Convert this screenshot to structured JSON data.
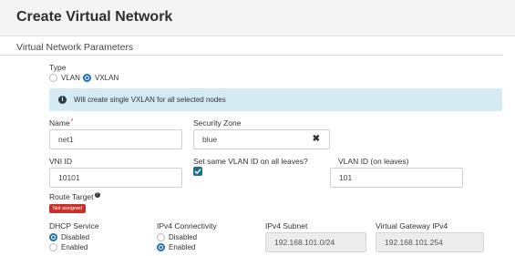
{
  "page": {
    "title": "Create Virtual Network"
  },
  "section": {
    "title": "Virtual Network Parameters"
  },
  "type_field": {
    "label": "Type",
    "options": [
      "VLAN",
      "VXLAN"
    ],
    "selected": "VXLAN"
  },
  "info": {
    "icon": "info-icon",
    "text": "Will create single VXLAN for all selected nodes"
  },
  "name_field": {
    "label": "Name",
    "required_mark": "*",
    "value": "net1"
  },
  "security_zone": {
    "label": "Security Zone",
    "value": "blue",
    "clear_icon": "close-icon",
    "clear_glyph": "✖"
  },
  "vni": {
    "label": "VNI ID",
    "value": "10101"
  },
  "same_vlan": {
    "label": "Set same VLAN ID on all leaves?",
    "checked": true
  },
  "vlan_id": {
    "label": "VLAN ID (on leaves)",
    "value": "101"
  },
  "route_target": {
    "label": "Route Target",
    "help_icon": "help-icon",
    "help_glyph": "?",
    "badge": "Not assigned"
  },
  "dhcp": {
    "label": "DHCP Service",
    "options": [
      "Disabled",
      "Enabled"
    ],
    "selected": "Disabled"
  },
  "ipv4_conn": {
    "label": "IPv4 Connectivity",
    "options": [
      "Disabled",
      "Enabled"
    ],
    "selected": "Enabled"
  },
  "ipv4_subnet": {
    "label": "IPv4 Subnet",
    "value": "192.168.101.0/24"
  },
  "gateway": {
    "label": "Virtual Gateway IPv4",
    "value": "192.168.101.254"
  },
  "colors": {
    "accent": "#1e6fb5",
    "info_bg": "#d5ebf4",
    "badge": "#c9302c",
    "checkbox": "#1f6d8c"
  }
}
